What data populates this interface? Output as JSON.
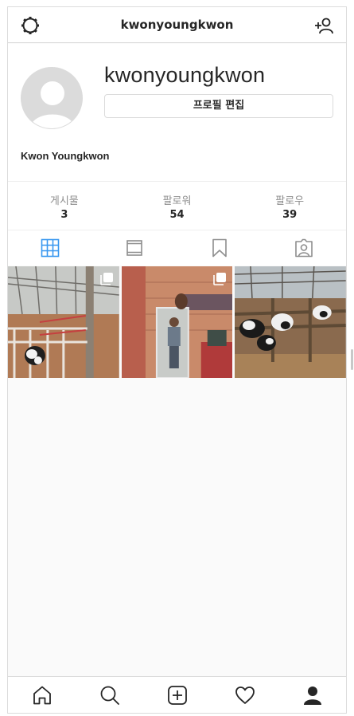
{
  "header": {
    "username": "kwonyoungkwon",
    "settings_icon": "gear-icon",
    "add_user_icon": "add-user-icon"
  },
  "profile": {
    "username": "kwonyoungkwon",
    "edit_button": "프로필 편집",
    "full_name": "Kwon Youngkwon"
  },
  "stats": [
    {
      "label": "게시물",
      "value": "3"
    },
    {
      "label": "팔로워",
      "value": "54"
    },
    {
      "label": "팔로우",
      "value": "39"
    }
  ],
  "tabs": [
    {
      "icon": "grid-icon",
      "active": true
    },
    {
      "icon": "feed-icon",
      "active": false
    },
    {
      "icon": "bookmark-icon",
      "active": false
    },
    {
      "icon": "tagged-icon",
      "active": false
    }
  ],
  "posts": [
    {
      "subject": "calf in barn stall",
      "multiple": true
    },
    {
      "subject": "person in mirror reflection",
      "multiple": true
    },
    {
      "subject": "holstein calves feeding",
      "multiple": false
    }
  ],
  "nav": [
    "home-icon",
    "search-icon",
    "new-post-icon",
    "activity-icon",
    "profile-icon"
  ],
  "colors": {
    "accent": "#3897f0",
    "border": "#dbdbdb",
    "muted": "#8e8e8e"
  }
}
